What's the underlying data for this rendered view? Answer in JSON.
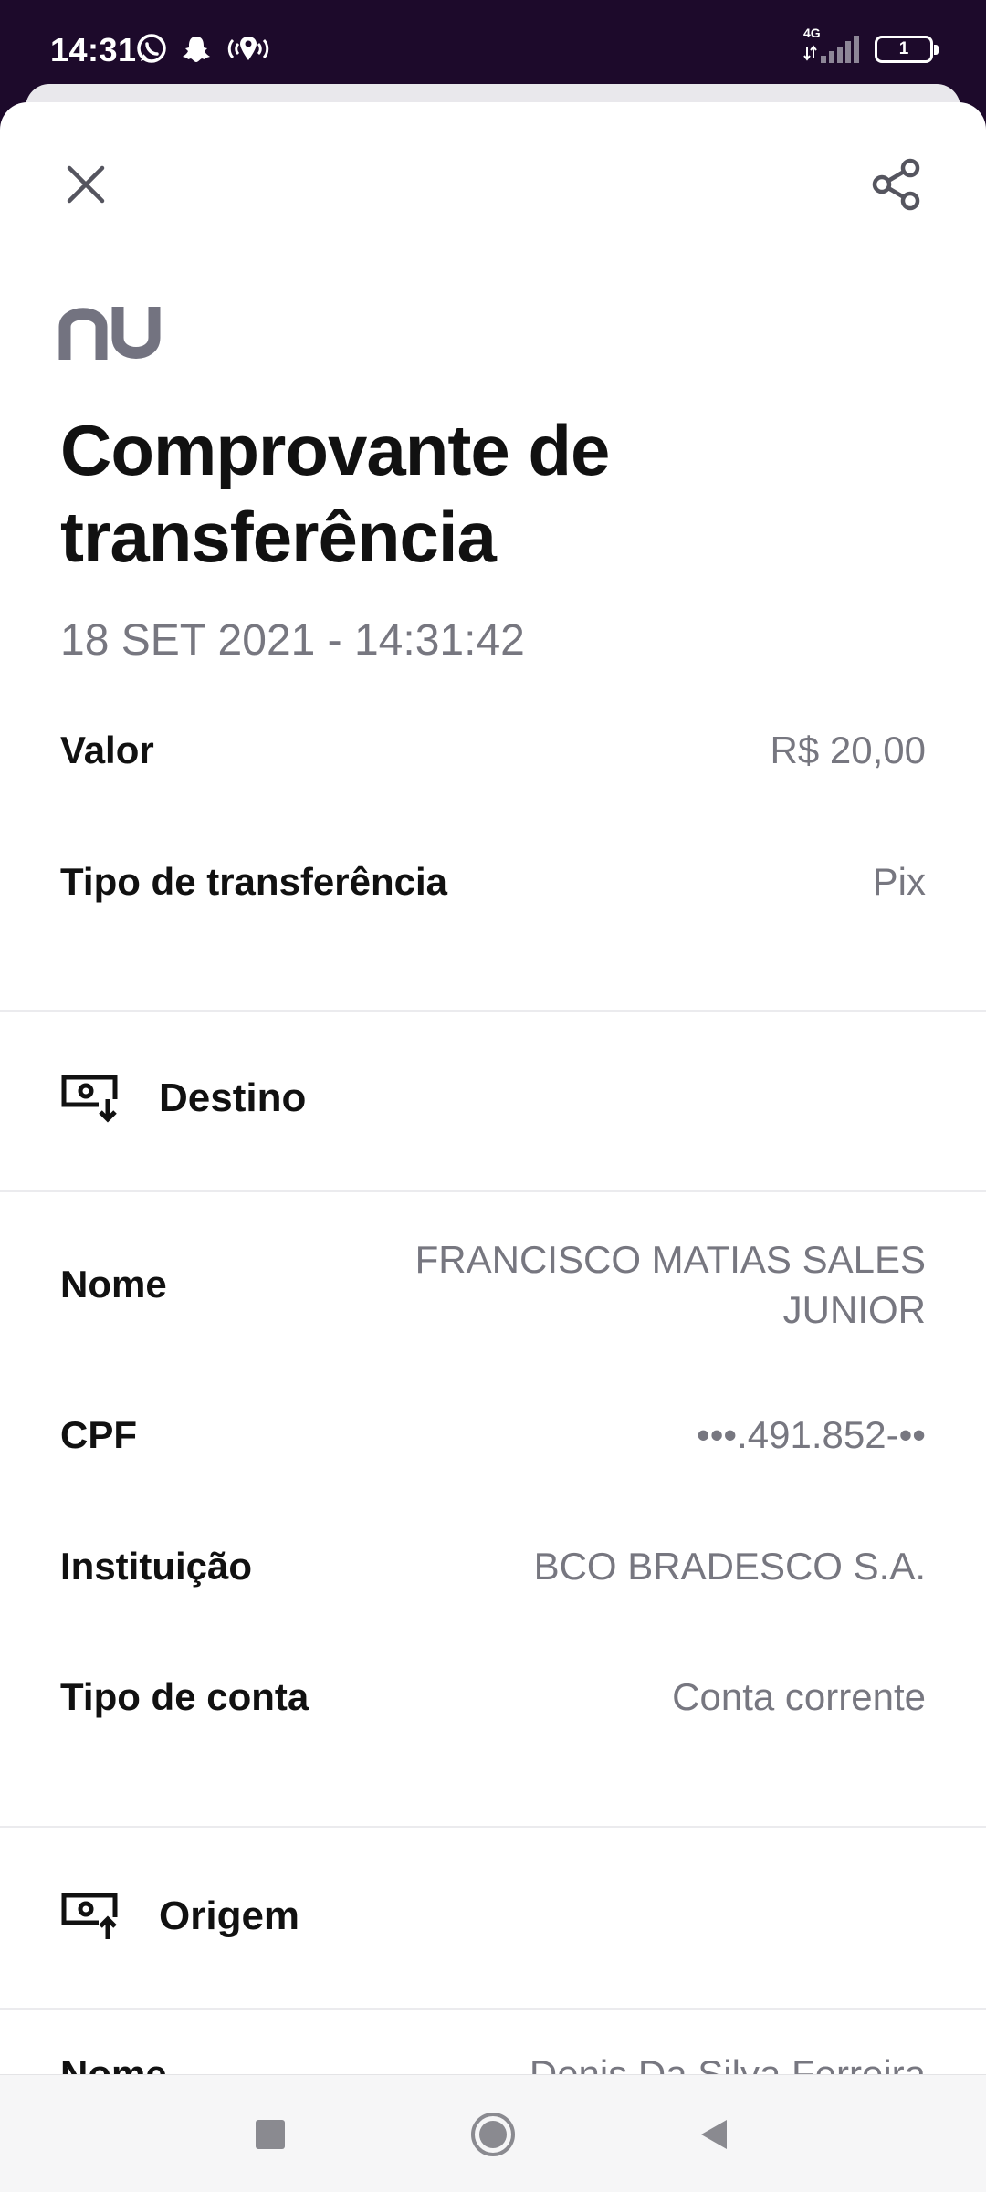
{
  "status_bar": {
    "time": "14:31",
    "network": "4G",
    "battery": "1",
    "icons": [
      "whatsapp-icon",
      "snapchat-icon",
      "location-broadcast-icon"
    ]
  },
  "header": {
    "close_icon": "close-icon",
    "share_icon": "share-icon"
  },
  "brand": {
    "logo_text": "nu",
    "color": "#737380"
  },
  "receipt": {
    "title": "Comprovante de transferência",
    "date": "18 SET 2021 - 14:31:42",
    "summary": [
      {
        "label": "Valor",
        "value": "R$ 20,00"
      },
      {
        "label": "Tipo de transferência",
        "value": "Pix"
      }
    ]
  },
  "destino": {
    "title": "Destino",
    "icon": "receive-money-icon",
    "fields": [
      {
        "label": "Nome",
        "value": "FRANCISCO MATIAS SALES JUNIOR"
      },
      {
        "label": "CPF",
        "value": "•••.491.852-••"
      },
      {
        "label": "Instituição",
        "value": "BCO BRADESCO S.A."
      },
      {
        "label": "Tipo de conta",
        "value": "Conta corrente"
      }
    ]
  },
  "origem": {
    "title": "Origem",
    "icon": "send-money-icon",
    "partial_row": {
      "label": "Nome",
      "value": "Denis Da Silva Ferreira"
    }
  },
  "nav": [
    "recents-button",
    "home-button",
    "back-button"
  ]
}
